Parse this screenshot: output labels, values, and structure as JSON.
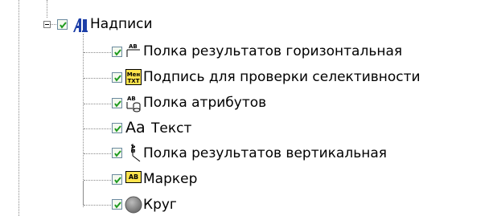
{
  "tree": {
    "root": {
      "label": "Надписи",
      "icon": "text-tool-icon",
      "checked": true,
      "expanded": true
    },
    "children": [
      {
        "label": "Полка результатов горизонтальная",
        "icon": "horizontal-result-shelf-icon",
        "icon_text": "AB",
        "checked": true
      },
      {
        "label": "Подпись для проверки селективности",
        "icon": "selectivity-caption-icon",
        "icon_text": [
          "Мен",
          "ТХТ"
        ],
        "checked": true
      },
      {
        "label": "Полка атрибутов",
        "icon": "attribute-shelf-icon",
        "icon_text": "AB",
        "checked": true
      },
      {
        "label": "Текст",
        "icon": "text-icon",
        "icon_text": "Aa",
        "checked": true
      },
      {
        "label": "Полка результатов вертикальная",
        "icon": "vertical-result-shelf-icon",
        "icon_text": "AB",
        "checked": true
      },
      {
        "label": "Маркер",
        "icon": "marker-icon",
        "icon_text": "AB",
        "checked": true
      },
      {
        "label": "Круг",
        "icon": "circle-icon",
        "checked": true
      }
    ]
  },
  "colors": {
    "check": "#1e9a1e",
    "accent_blue": "#1d3fa8",
    "marker_yellow": "#ffe34d",
    "circle_gray": "#8a8a8a"
  }
}
